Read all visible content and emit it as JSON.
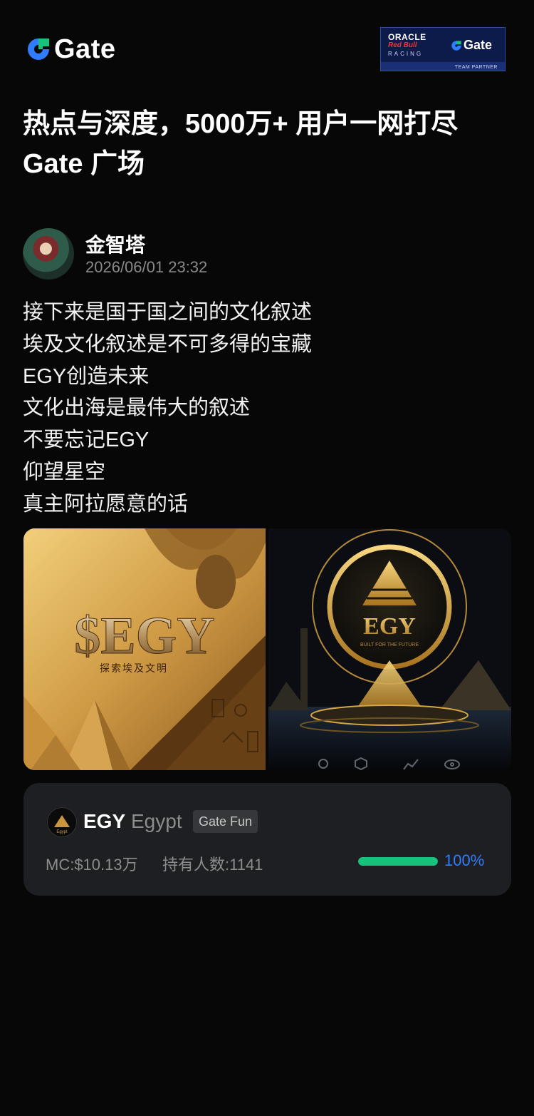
{
  "header": {
    "brand": "Gate",
    "partner": {
      "line1": "ORACLE",
      "line2": "Red Bull",
      "line3": "RACING",
      "brand": "Gate",
      "tag": "TEAM PARTNER"
    }
  },
  "headline": {
    "line1": "热点与深度，5000万+ 用户一网打尽",
    "line2": "Gate 广场"
  },
  "post": {
    "author": "金智塔",
    "time": "2026/06/01 23:32",
    "lines": [
      "接下来是国于国之间的文化叙述",
      "埃及文化叙述是不可多得的宝藏",
      "EGY创造未来",
      "文化出海是最伟大的叙述",
      "不要忘记EGY",
      "仰望星空",
      "真主阿拉愿意的话"
    ],
    "images": [
      {
        "title": "$EGY",
        "caption": "探索埃及文明"
      },
      {
        "title": "EGY",
        "caption": "BUILT FOR THE FUTURE"
      }
    ]
  },
  "token": {
    "symbol": "EGY",
    "name": "Egypt",
    "logo_text": "Egypt",
    "badge": "Gate Fun",
    "mc": "MC:$10.13万",
    "holders": "持有人数:1141",
    "progress": 1.0,
    "progress_text": "100%"
  },
  "colors": {
    "background": "#070707",
    "brand_blue": "#2f7cff",
    "brand_green": "#17c27a",
    "card": "#1e1f22"
  }
}
